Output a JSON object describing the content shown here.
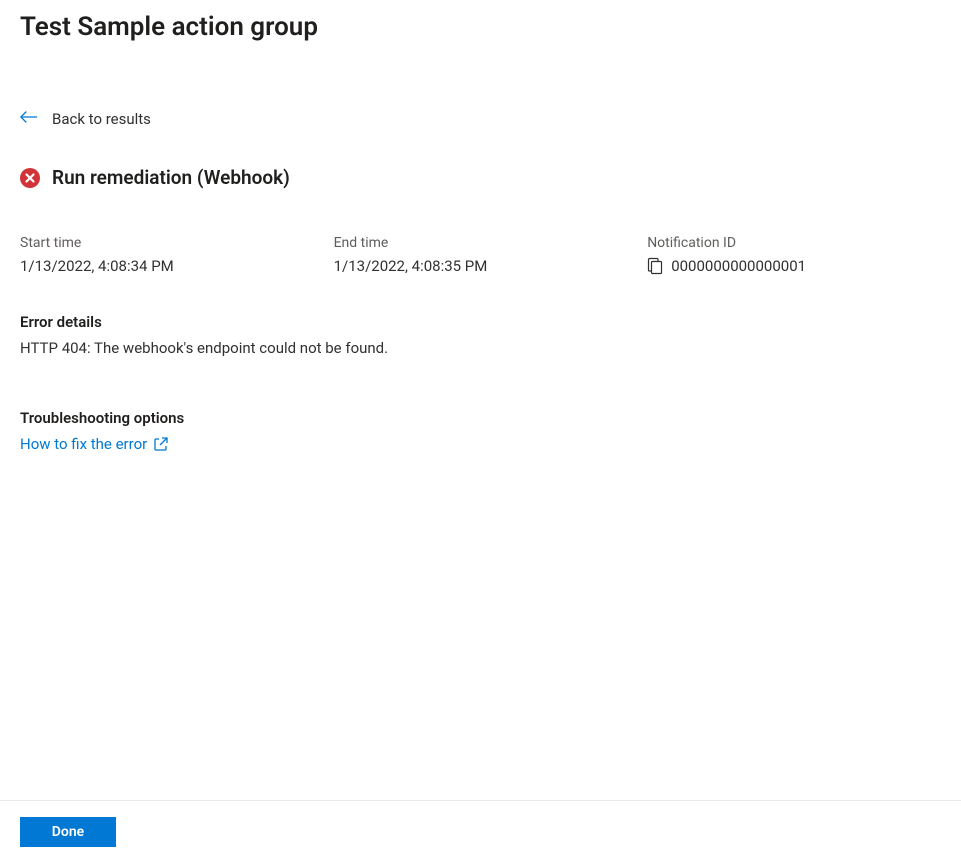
{
  "header": {
    "title": "Test Sample action group"
  },
  "nav": {
    "back_label": "Back to results"
  },
  "status": {
    "title": "Run remediation (Webhook)",
    "icon": "error-circle-icon"
  },
  "info": {
    "start_time_label": "Start time",
    "start_time_value": "1/13/2022, 4:08:34 PM",
    "end_time_label": "End time",
    "end_time_value": "1/13/2022, 4:08:35 PM",
    "notification_id_label": "Notification ID",
    "notification_id_value": "0000000000000001"
  },
  "error": {
    "heading": "Error details",
    "message": "HTTP 404: The webhook's endpoint could not be found."
  },
  "troubleshoot": {
    "heading": "Troubleshooting options",
    "link_label": "How to fix the error"
  },
  "footer": {
    "done_label": "Done"
  },
  "colors": {
    "primary": "#0078d4",
    "error": "#d13438",
    "text": "#323130",
    "muted": "#605e5c"
  }
}
